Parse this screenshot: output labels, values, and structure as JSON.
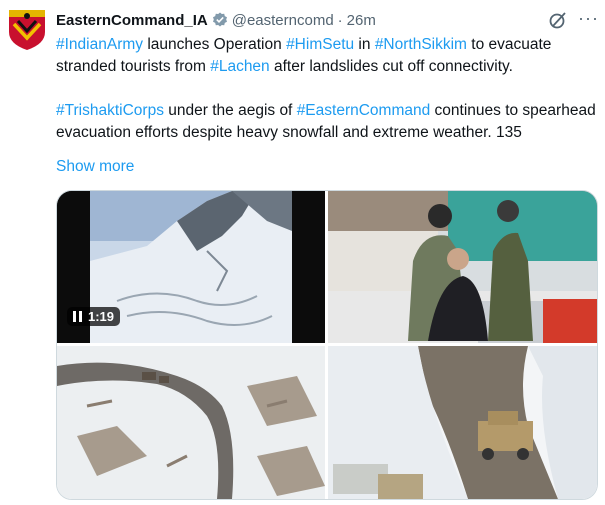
{
  "author": {
    "name": "EasternCommand_IA",
    "handle": "@easterncomd",
    "time": "26m"
  },
  "icons": {
    "verified": "verified-badge-icon",
    "grok": "grok-icon",
    "more": "more-options-icon",
    "pause": "pause-icon"
  },
  "colors": {
    "link": "#1d9bf0",
    "verified": "#829aab",
    "text": "#0f1419",
    "muted": "#536471"
  },
  "tweet": {
    "p1": [
      {
        "t": "#IndianArmy",
        "tag": true
      },
      {
        "t": " launches Operation ",
        "tag": false
      },
      {
        "t": "#HimSetu",
        "tag": true
      },
      {
        "t": " in ",
        "tag": false
      },
      {
        "t": "#NorthSikkim",
        "tag": true
      },
      {
        "t": " to evacuate stranded tourists from ",
        "tag": false
      },
      {
        "t": "#Lachen",
        "tag": true
      },
      {
        "t": " after landslides cut off connectivity.",
        "tag": false
      }
    ],
    "p2": [
      {
        "t": "#TrishaktiCorps",
        "tag": true
      },
      {
        "t": " under the aegis of ",
        "tag": false
      },
      {
        "t": "#EasternCommand",
        "tag": true
      },
      {
        "t": " continues to spearhead evacuation efforts despite heavy snowfall and extreme weather. 135",
        "tag": false
      }
    ],
    "show_more": "Show more"
  },
  "media": {
    "video_time": "1:19"
  }
}
